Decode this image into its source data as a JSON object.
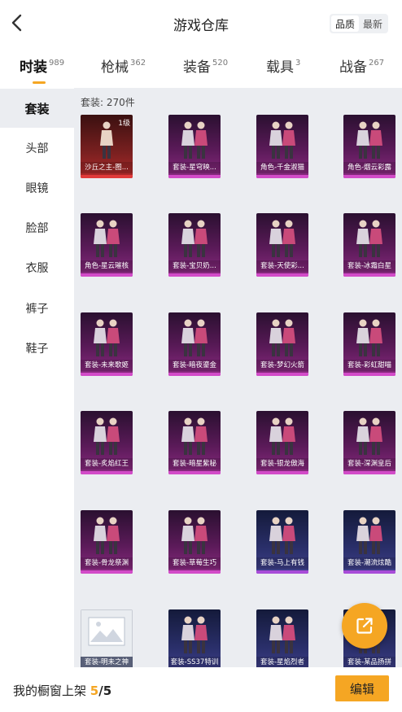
{
  "header": {
    "title": "游戏仓库",
    "back_icon": "chevron-left-icon",
    "sort_options": [
      "品质",
      "最新"
    ],
    "sort_selected": "品质"
  },
  "tabs": [
    {
      "label": "时装",
      "count": "989",
      "active": true
    },
    {
      "label": "枪械",
      "count": "362",
      "active": false
    },
    {
      "label": "装备",
      "count": "520",
      "active": false
    },
    {
      "label": "载具",
      "count": "3",
      "active": false
    },
    {
      "label": "战备",
      "count": "267",
      "active": false
    }
  ],
  "sidebar": {
    "items": [
      {
        "label": "套装",
        "active": true
      },
      {
        "label": "头部",
        "active": false
      },
      {
        "label": "眼镜",
        "active": false
      },
      {
        "label": "脸部",
        "active": false
      },
      {
        "label": "衣服",
        "active": false
      },
      {
        "label": "裤子",
        "active": false
      },
      {
        "label": "鞋子",
        "active": false
      }
    ]
  },
  "content": {
    "count_label": "套装: 270件",
    "items": [
      {
        "name": "沙丘之主-图...",
        "rarity": "red",
        "level": "1级"
      },
      {
        "name": "套装-星穹映...",
        "rarity": "purple"
      },
      {
        "name": "角色-千金淑猫",
        "rarity": "purple"
      },
      {
        "name": "角色-烟云彩露",
        "rarity": "purple"
      },
      {
        "name": "角色-星云璀核",
        "rarity": "purple"
      },
      {
        "name": "套装-宝贝奶...",
        "rarity": "purple"
      },
      {
        "name": "套装-天使彩...",
        "rarity": "purple"
      },
      {
        "name": "套装-冰霜白星",
        "rarity": "purple"
      },
      {
        "name": "套装-未来歌姬",
        "rarity": "purple"
      },
      {
        "name": "套装-暗夜鎏金",
        "rarity": "purple"
      },
      {
        "name": "套装-梦幻火箭",
        "rarity": "purple"
      },
      {
        "name": "套装-彩虹甜喵",
        "rarity": "purple"
      },
      {
        "name": "套装-炙焰红王",
        "rarity": "purple"
      },
      {
        "name": "套装-暗星紫秘",
        "rarity": "purple"
      },
      {
        "name": "套装-银龙傲海",
        "rarity": "purple"
      },
      {
        "name": "套装-深渊皇后",
        "rarity": "purple"
      },
      {
        "name": "套装-骨龙祭渊",
        "rarity": "purple"
      },
      {
        "name": "套装-草莓生巧",
        "rarity": "purple"
      },
      {
        "name": "套装-马上有钱",
        "rarity": "blue"
      },
      {
        "name": "套装-潮流炫酷",
        "rarity": "blue"
      },
      {
        "name": "套装-明未之神",
        "rarity": "gray"
      },
      {
        "name": "套装-SS37特训",
        "rarity": "blue"
      },
      {
        "name": "套装-星焰烈者",
        "rarity": "blue"
      },
      {
        "name": "套装-某品扬拼",
        "rarity": "blue"
      }
    ]
  },
  "fab": {
    "icon": "share-external-icon"
  },
  "footer": {
    "label": "我的橱窗上架",
    "current": "5",
    "separator": "/",
    "max": "5",
    "edit_label": "编辑"
  },
  "colors": {
    "accent": "#f5a623",
    "purple_rarity": "#d24bc8",
    "red_rarity": "#e03a3a",
    "content_bg": "#ebedf1"
  }
}
